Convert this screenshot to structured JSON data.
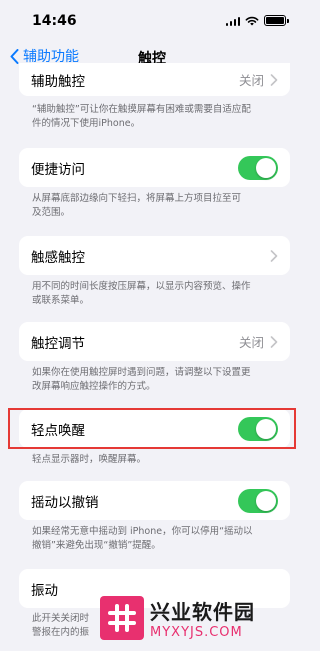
{
  "status_bar": {
    "time": "14:46"
  },
  "nav": {
    "back_label": "辅助功能",
    "title": "触控"
  },
  "rows": [
    {
      "label": "辅助触控",
      "value": "关闭"
    },
    {
      "label": "便捷访问"
    },
    {
      "label": "触感触控"
    },
    {
      "label": "触控调节",
      "value": "关闭"
    },
    {
      "label": "轻点唤醒"
    },
    {
      "label": "摇动以撤销"
    },
    {
      "label": "振动"
    }
  ],
  "notes": {
    "assistive_1": "“辅助触控”可让你在触摸屏幕有困难或需要自适应配",
    "assistive_2": "件的情况下使用iPhone。",
    "reachability_1": "从屏幕底部边缘向下轻扫，将屏幕上方项目拉至可",
    "reachability_2": "及范围。",
    "haptic_1": "用不同的时间长度按压屏幕，以显示内容预览、操作",
    "haptic_2": "或联系菜单。",
    "accom_1": "如果你在使用触控屏时遇到问题，请调整以下设置更",
    "accom_2": "改屏幕响应触控操作的方式。",
    "tap_to_wake": "轻点显示器时，唤醒屏幕。",
    "shake_1": "如果经常无意中摇动到 iPhone，你可以停用“摇动以",
    "shake_2": "撤销”来避免出现“撤销”提醒。",
    "vibration_1": "此开关关闭时",
    "vibration_2": "警报在内的振"
  },
  "toggles": {
    "reachability": true,
    "tap_to_wake": true,
    "shake_to_undo": true
  },
  "watermark": {
    "title": "兴业软件园",
    "url": "MYXYJS.COM"
  },
  "colors": {
    "accent": "#0a7aff",
    "toggle_on": "#34c759",
    "highlight": "#e53935",
    "watermark": "#e8306f"
  }
}
